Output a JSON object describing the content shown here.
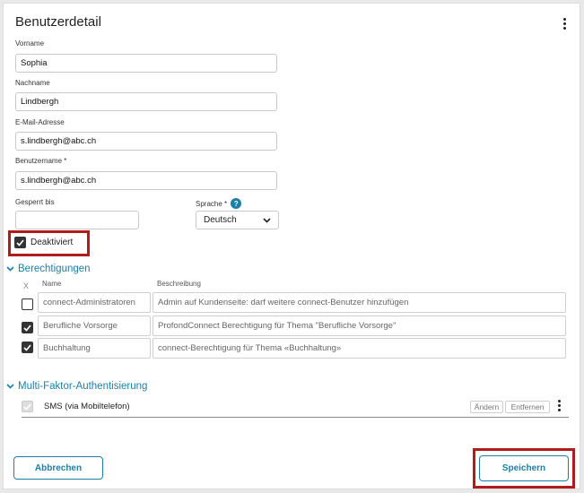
{
  "header": {
    "title": "Benutzerdetail"
  },
  "form": {
    "vorname": {
      "label": "Vorname",
      "value": "Sophia"
    },
    "nachname": {
      "label": "Nachname",
      "value": "Lindbergh"
    },
    "email": {
      "label": "E-Mail-Adresse",
      "value": "s.lindbergh@abc.ch"
    },
    "username": {
      "label": "Benutzername *",
      "value": "s.lindbergh@abc.ch"
    },
    "gesperrt": {
      "label": "Gesperrt bis",
      "value": ""
    },
    "sprache": {
      "label": "Sprache *",
      "value": "Deutsch"
    },
    "deaktiviert": {
      "label": "Deaktiviert",
      "checked": true
    }
  },
  "permissions": {
    "title": "Berechtigungen",
    "columns": {
      "x": "X",
      "name": "Name",
      "description": "Beschreibung"
    },
    "rows": [
      {
        "checked": false,
        "name": "connect-Administratoren",
        "description": "Admin auf Kundenseite: darf weitere connect-Benutzer hinzufügen"
      },
      {
        "checked": true,
        "name": "Berufliche Vorsorge",
        "description": "ProfondConnect Berechtigung für Thema \"Berufliche Vorsorge\""
      },
      {
        "checked": true,
        "name": "Buchhaltung",
        "description": "connect-Berechtigung für Thema «Buchhaltung»"
      }
    ]
  },
  "mfa": {
    "title": "Multi-Faktor-Authentisierung",
    "item": "SMS (via Mobiltelefon)",
    "change_label": "Ändern",
    "remove_label": "Entfernen"
  },
  "footer": {
    "cancel_label": "Abbrechen",
    "save_label": "Speichern"
  },
  "colors": {
    "accent": "#1b7fa7",
    "highlight": "#b01c1c"
  }
}
